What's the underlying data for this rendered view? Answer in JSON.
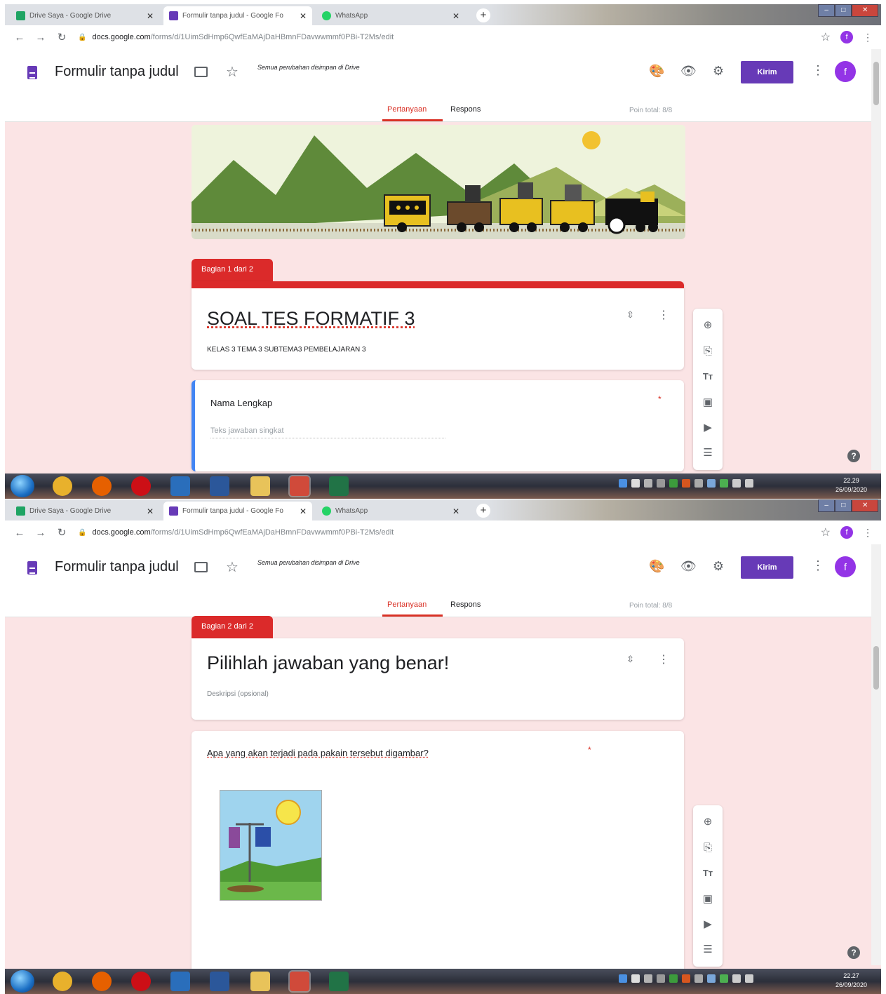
{
  "browser": {
    "tabs": [
      {
        "title": "Drive Saya - Google Drive",
        "favicon_color": "#1fa463"
      },
      {
        "title": "Formulir tanpa judul - Google Fo",
        "favicon_color": "#673ab7"
      },
      {
        "title": "WhatsApp",
        "favicon_color": "#25d366"
      }
    ],
    "url_host": "docs.google.com",
    "url_path": "/forms/d/1UimSdHmp6QwfEaMAjDaHBmnFDavwwmmf0PBi-T2Ms/edit",
    "profile_letter": "f"
  },
  "form_header": {
    "title": "Formulir tanpa judul",
    "save_note": "Semua perubahan disimpan di Drive",
    "send_label": "Kirim",
    "avatar_letter": "f",
    "tabs": {
      "questions": "Pertanyaan",
      "responses": "Respons"
    },
    "points_total": "Poin total: 8/8"
  },
  "screen1": {
    "section_label": "Bagian 1 dari 2",
    "section_title": "SOAL TES FORMATIF 3",
    "section_description": "KELAS 3 TEMA 3 SUBTEMA3 PEMBELAJARAN 3",
    "question_title": "Nama Lengkap",
    "question_placeholder": "Teks jawaban singkat",
    "clock_time": "22.29",
    "clock_date": "26/09/2020"
  },
  "screen2": {
    "section_label": "Bagian 2 dari 2",
    "section_title": "Pilihlah jawaban yang benar!",
    "section_description": "Deskripsi (opsional)",
    "question_title": "Apa yang akan terjadi pada pakain tersebut digambar?",
    "clock_time": "22.27",
    "clock_date": "26/09/2020"
  },
  "toolbar_icons": [
    "add-question-icon",
    "import-questions-icon",
    "add-title-icon",
    "add-image-icon",
    "add-video-icon",
    "add-section-icon"
  ],
  "taskbar_apps": [
    {
      "name": "chrome-icon",
      "color": "#e8b12c"
    },
    {
      "name": "firefox-icon",
      "color": "#e66000"
    },
    {
      "name": "opera-icon",
      "color": "#cc0f16"
    },
    {
      "name": "app-icon",
      "color": "#2a6ebb"
    },
    {
      "name": "word-icon",
      "color": "#2b579a"
    },
    {
      "name": "explorer-icon",
      "color": "#e8c35a"
    },
    {
      "name": "chrome-active-icon",
      "color": "#d04a3a"
    },
    {
      "name": "excel-icon",
      "color": "#217346"
    }
  ]
}
